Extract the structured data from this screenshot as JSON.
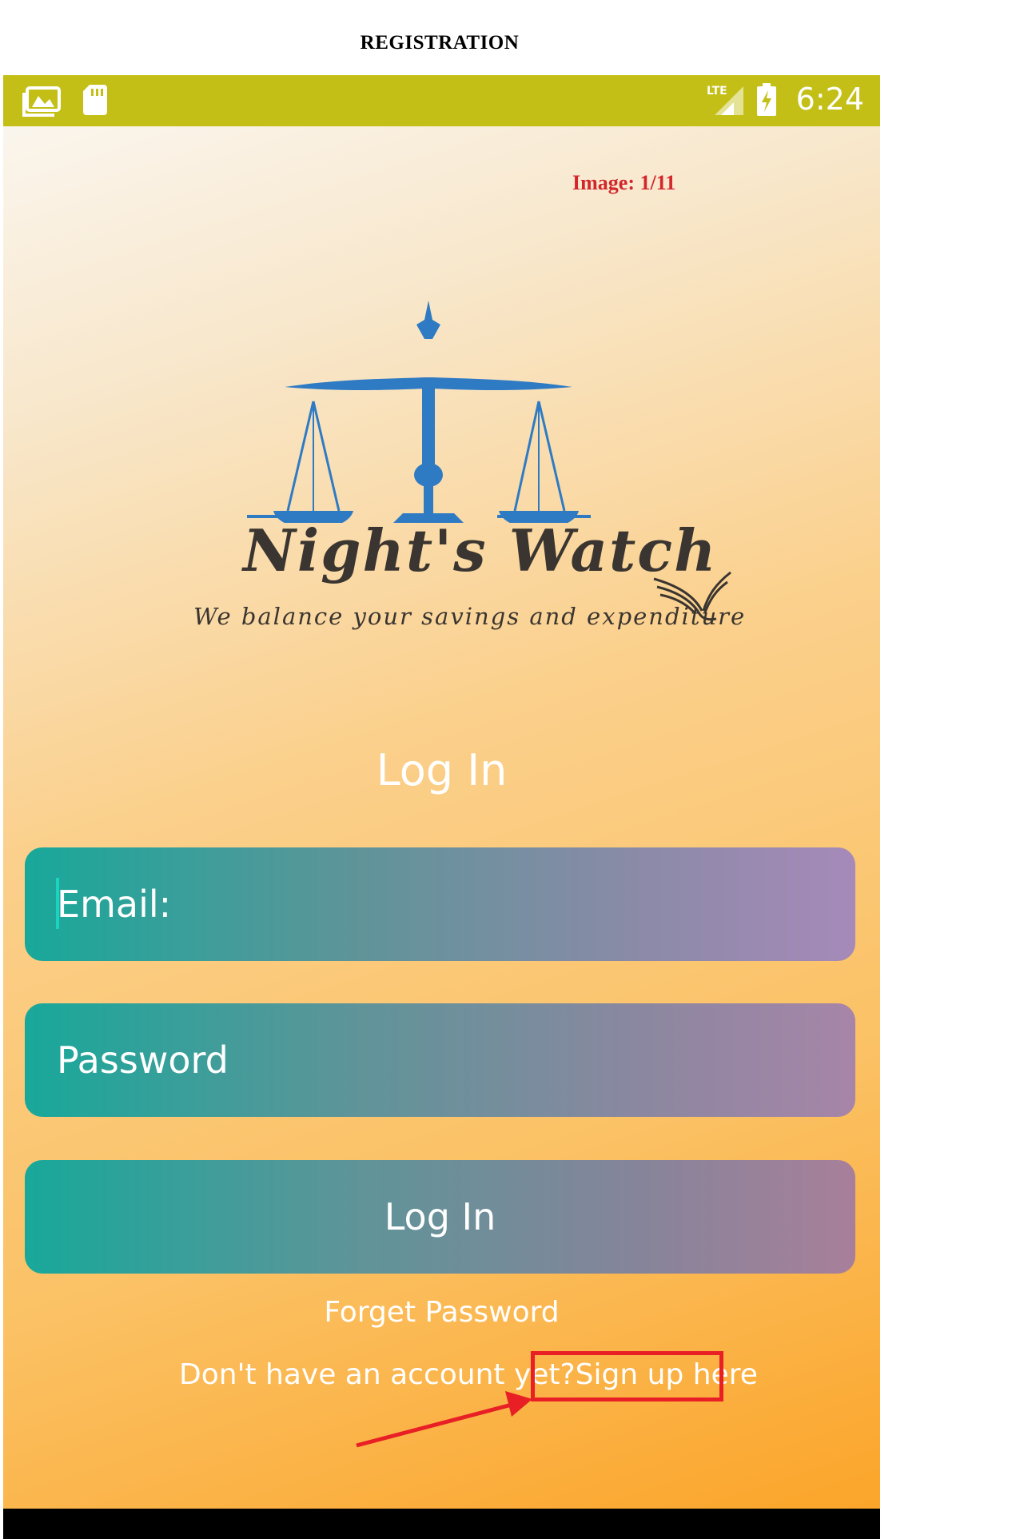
{
  "document": {
    "title": "REGISTRATION"
  },
  "status_bar": {
    "left_icons": [
      "gallery-icon",
      "sd-card-icon"
    ],
    "network": "LTE",
    "time": "6:24",
    "background_color": "#c3bf16"
  },
  "annotation": {
    "image_counter": "Image: 1/11",
    "highlight_color": "#e81f25"
  },
  "logo": {
    "title": "Night's Watch",
    "tagline": "We balance your savings and expenditure",
    "icon": "scales-of-justice-icon",
    "brand_color": "#2e7bc4"
  },
  "login": {
    "heading": "Log In",
    "email_placeholder": "Email:",
    "password_placeholder": "Password",
    "submit_label": "Log In",
    "forgot_label": "Forget Password",
    "no_account_text": "Don't have an account yet?",
    "signup_label": "Sign up here"
  }
}
